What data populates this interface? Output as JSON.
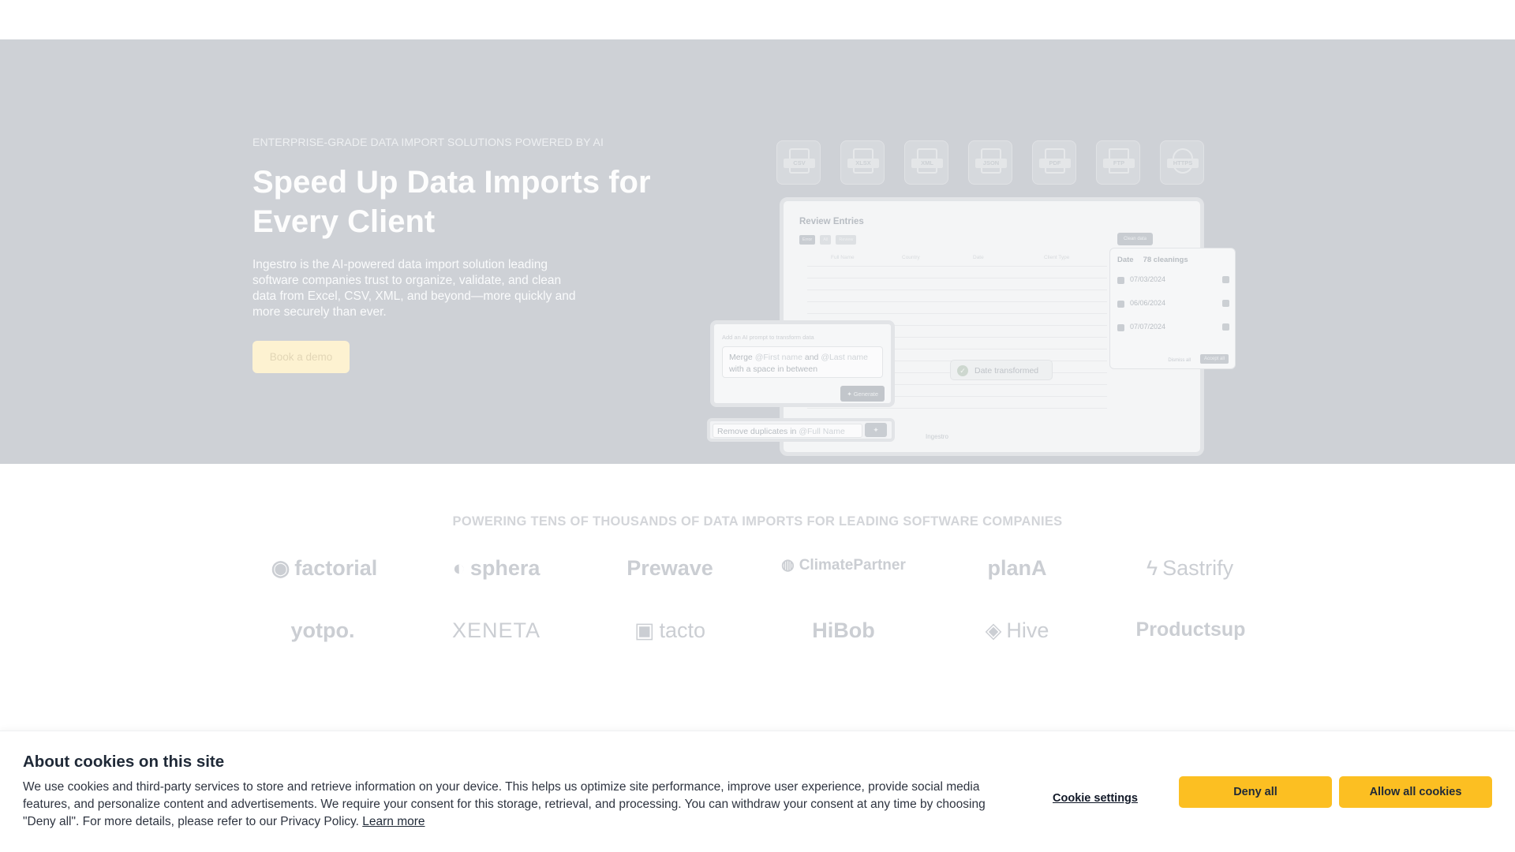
{
  "hero": {
    "eyebrow": "ENTERPRISE-GRADE DATA IMPORT SOLUTIONS POWERED BY AI",
    "title": "Speed Up Data Imports for Every Client",
    "lead": "Ingestro is the AI-powered data import solution leading software companies trust to organize, validate, and clean data from Excel, CSV, XML, and beyond—more quickly and more securely than ever.",
    "cta": "Book a demo"
  },
  "formats": [
    "CSV",
    "XLSX",
    "XML",
    "JSON",
    "PDF",
    "FTP",
    "HTTPS"
  ],
  "mockup": {
    "card_title": "Review Entries",
    "pills": [
      "Error",
      "All",
      "Review"
    ],
    "clean_button": "Clean data",
    "columns": [
      "Full Name",
      "Country",
      "Date",
      "Client Type"
    ],
    "powered_by": "Ingestro",
    "prompt_label": "Add an AI prompt to transform data",
    "prompt_pre": "Merge ",
    "prompt_tok1": "@First name",
    "prompt_mid": " and ",
    "prompt_tok2": "@Last name",
    "prompt_post": " with a space in between",
    "generate": "Generate",
    "dedupe_pre": "Remove duplicates in ",
    "dedupe_tok": "@Full Name",
    "toast": "Date transformed",
    "dates_header": "Date",
    "dates_count": "78 cleanings",
    "dates": [
      {
        "new": "07/03/2024"
      },
      {
        "new": "06/06/2024"
      },
      {
        "new": "07/07/2024"
      }
    ],
    "dismiss_all": "Dismiss all",
    "accept_all": "Accept all"
  },
  "powering": "POWERING TENS OF THOUSANDS OF DATA IMPORTS FOR LEADING SOFTWARE COMPANIES",
  "logos": [
    "factorial",
    "sphera",
    "Prewave",
    "ClimatePartner",
    "planA",
    "Sastrify",
    "yotpo.",
    "XENETA",
    "tacto",
    "HiBob",
    "Hive",
    "Productsup"
  ],
  "cookie": {
    "title": "About cookies on this site",
    "body": "We use cookies and third-party services to store and retrieve information on your device. This helps us optimize site performance, improve user experience, provide social media features, and personalize content and advertisements. We require your consent for this storage, retrieval, and processing. You can withdraw your consent at any time by choosing \"Deny all\". For more details, please refer to our Privacy Policy.",
    "learn_more": "Learn more",
    "settings": "Cookie settings",
    "deny": "Deny all",
    "allow": "Allow all cookies"
  }
}
